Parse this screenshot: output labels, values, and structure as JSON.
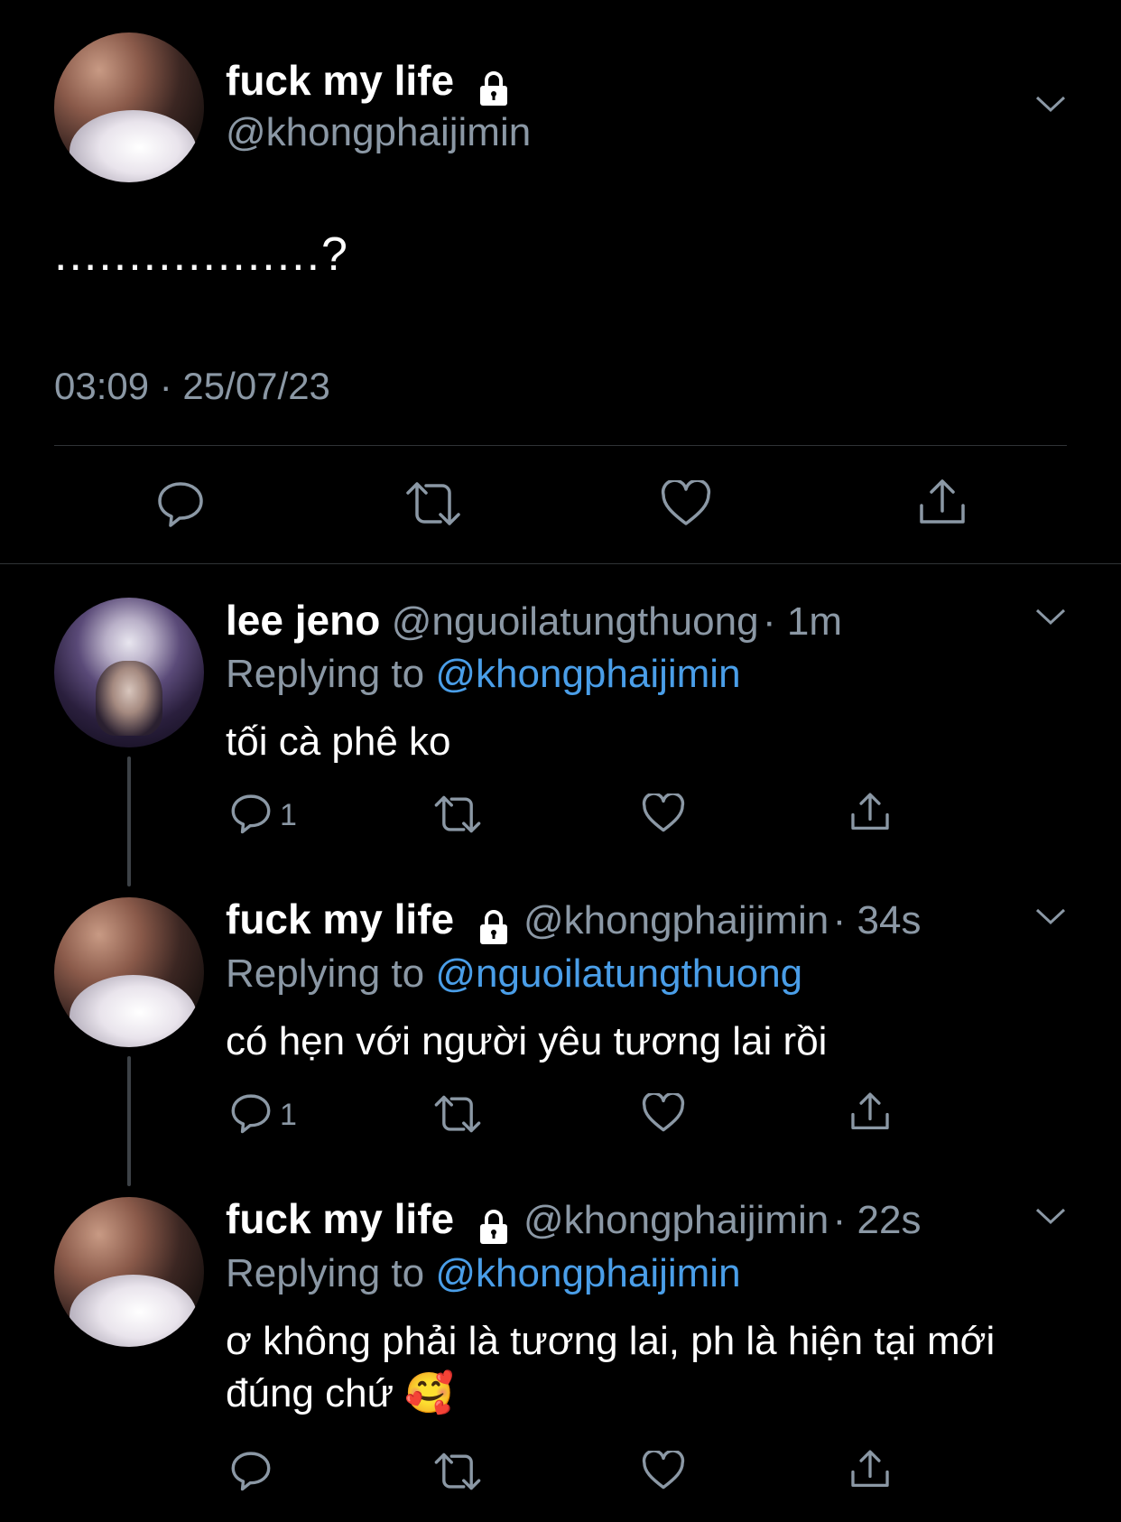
{
  "main_tweet": {
    "display_name": "fuck my life",
    "handle": "@khongphaijimin",
    "text": "..................?",
    "timestamp": "03:09 · 25/07/23"
  },
  "replies": [
    {
      "display_name": "lee jeno",
      "handle": "@nguoilatungthuong",
      "time": "· 1m",
      "replying_prefix": "Replying to ",
      "replying_to": "@khongphaijimin",
      "text": "tối cà phê ko",
      "reply_count": "1"
    },
    {
      "display_name": "fuck my life",
      "handle": "@khongphaijimin",
      "time": "· 34s",
      "replying_prefix": "Replying to ",
      "replying_to": "@nguoilatungthuong",
      "text": "có hẹn với người yêu tương lai rồi",
      "reply_count": "1"
    },
    {
      "display_name": "fuck my life",
      "handle": "@khongphaijimin",
      "time": "· 22s",
      "replying_prefix": "Replying to ",
      "replying_to": "@khongphaijimin",
      "text_line1": "ơ không phải là tương lai, ph là hiện tại mới",
      "text_line2": "đúng chứ 🥰",
      "reply_count": ""
    }
  ],
  "colors": {
    "background": "#000000",
    "muted": "#8b98a5",
    "mention": "#4a9ee8",
    "divider": "#2f3336"
  },
  "icons": [
    "lock-icon",
    "chevron-down-icon",
    "reply-icon",
    "retweet-icon",
    "like-icon",
    "share-icon"
  ]
}
